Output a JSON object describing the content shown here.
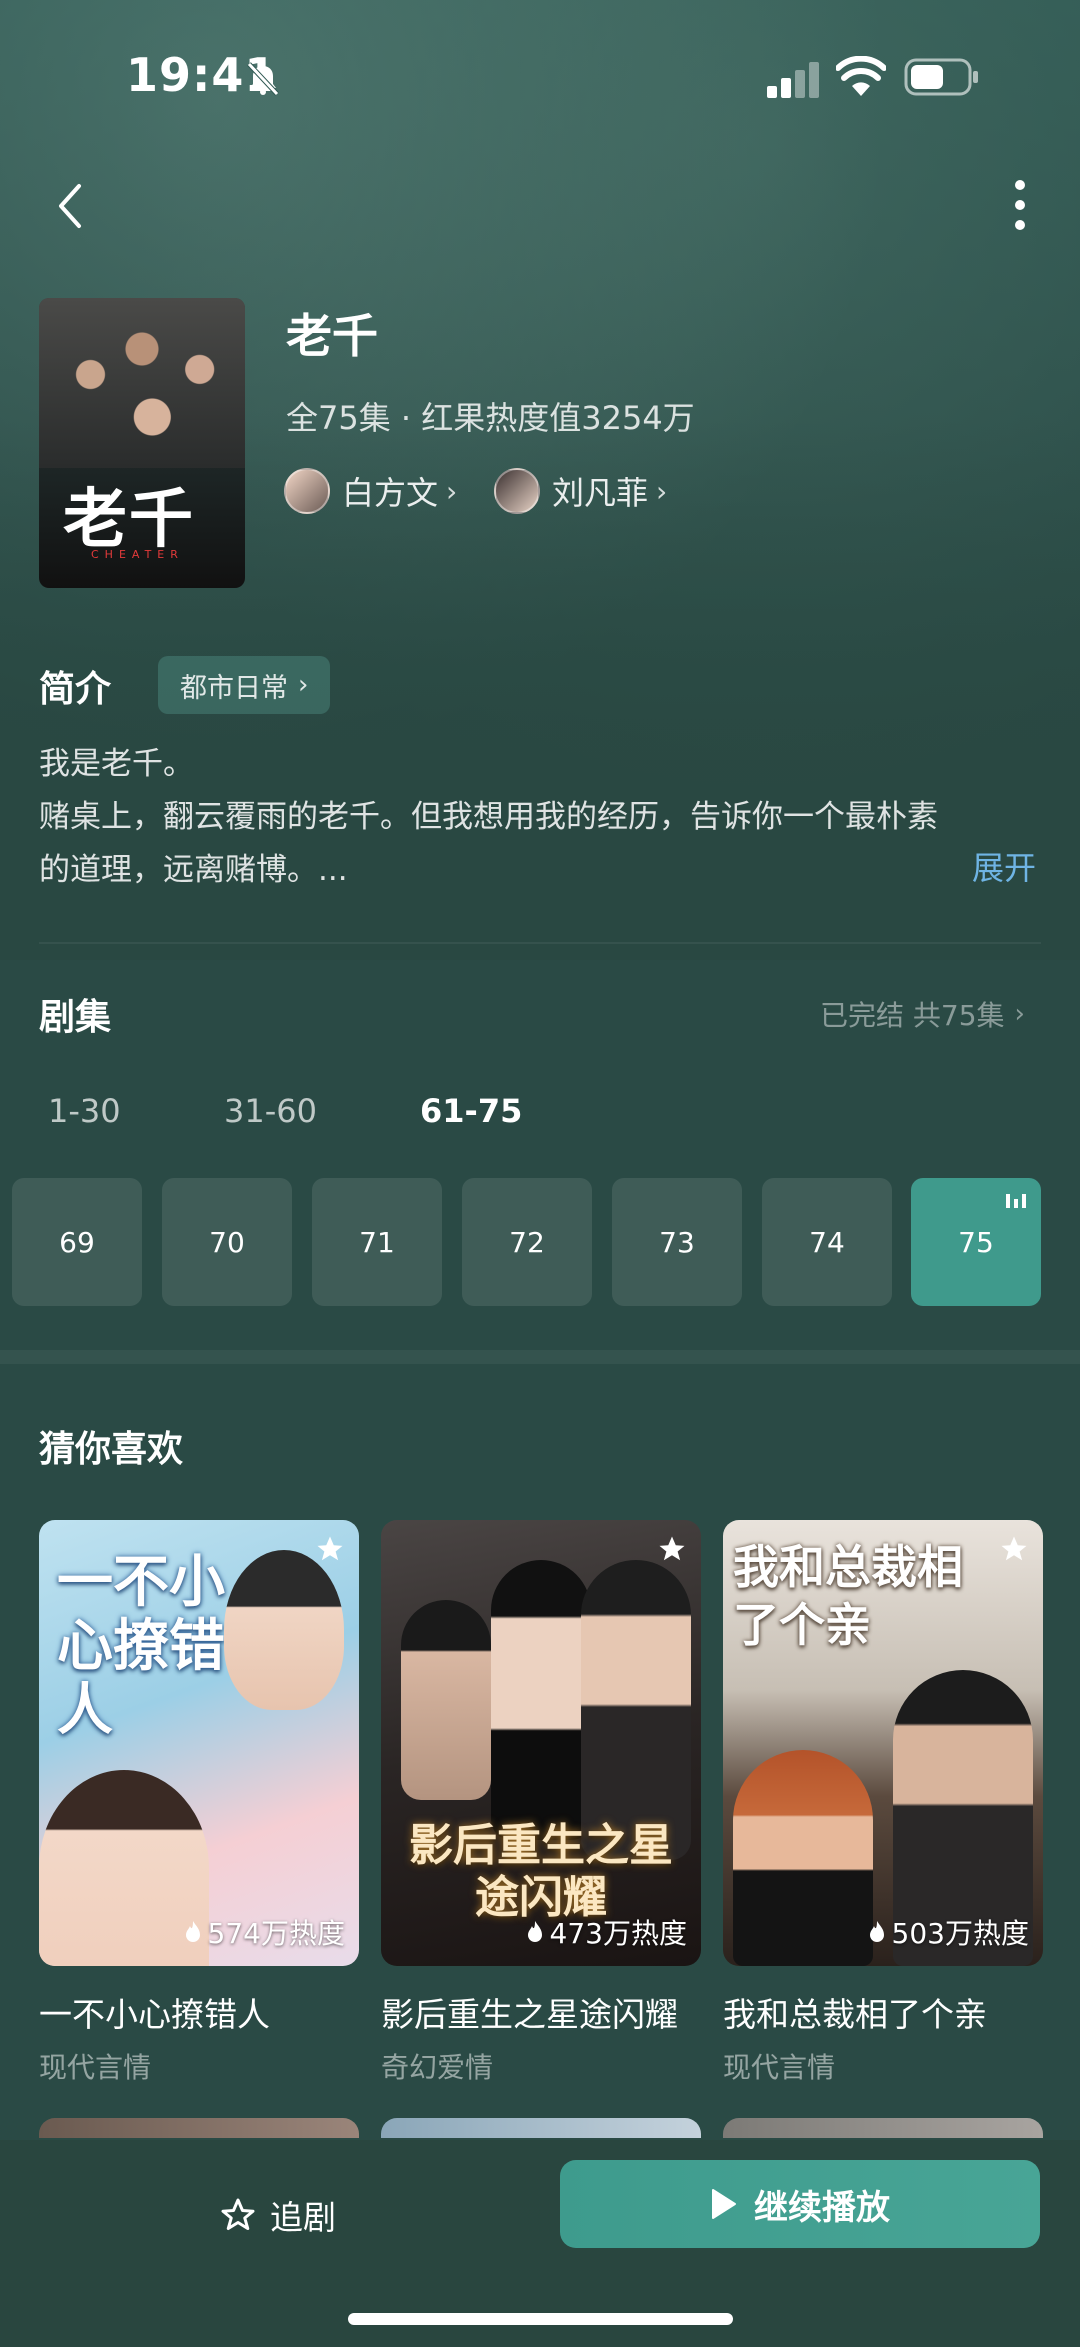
{
  "status_bar": {
    "time": "19:41",
    "icons": [
      "mute-icon",
      "signal-icon",
      "wifi-icon",
      "battery-icon"
    ]
  },
  "nav": {
    "back_icon": "chevron-left-icon",
    "more_icon": "more-vertical-icon"
  },
  "show": {
    "title": "老千",
    "meta": "全75集 · 红果热度值3254万",
    "poster_title": "老千",
    "poster_subtitle": "CHEATER",
    "actors": [
      {
        "name": "白方文"
      },
      {
        "name": "刘凡菲"
      }
    ]
  },
  "intro": {
    "heading": "简介",
    "tag": "都市日常",
    "text_line1": "我是老千。",
    "text_line2": "赌桌上，翻云覆雨的老千。但我想用我的经历，告诉你一个最朴素",
    "text_line3": "的道理，远离赌博。...",
    "expand": "展开"
  },
  "episodes": {
    "heading": "剧集",
    "status": "已完结 共75集",
    "ranges": [
      "1-30",
      "31-60",
      "61-75"
    ],
    "active_range": "61-75",
    "items": [
      "69",
      "70",
      "71",
      "72",
      "73",
      "74",
      "75"
    ],
    "current": "75"
  },
  "recommend": {
    "heading": "猜你喜欢",
    "items": [
      {
        "title": "一不小心撩错人",
        "genre": "现代言情",
        "heat": "574万热度",
        "cover_text": "一不小心撩错人"
      },
      {
        "title": "影后重生之星途闪耀",
        "genre": "奇幻爱情",
        "heat": "473万热度",
        "cover_text": "影后重生之星途闪耀"
      },
      {
        "title": "我和总裁相了个亲",
        "genre": "现代言情",
        "heat": "503万热度",
        "cover_text": "我和总裁相了个亲"
      }
    ]
  },
  "bottom": {
    "follow": "追剧",
    "play": "继续播放"
  },
  "colors": {
    "background": "#2a4a45",
    "accent": "#3f9a8c",
    "link": "#6fb4e4"
  }
}
